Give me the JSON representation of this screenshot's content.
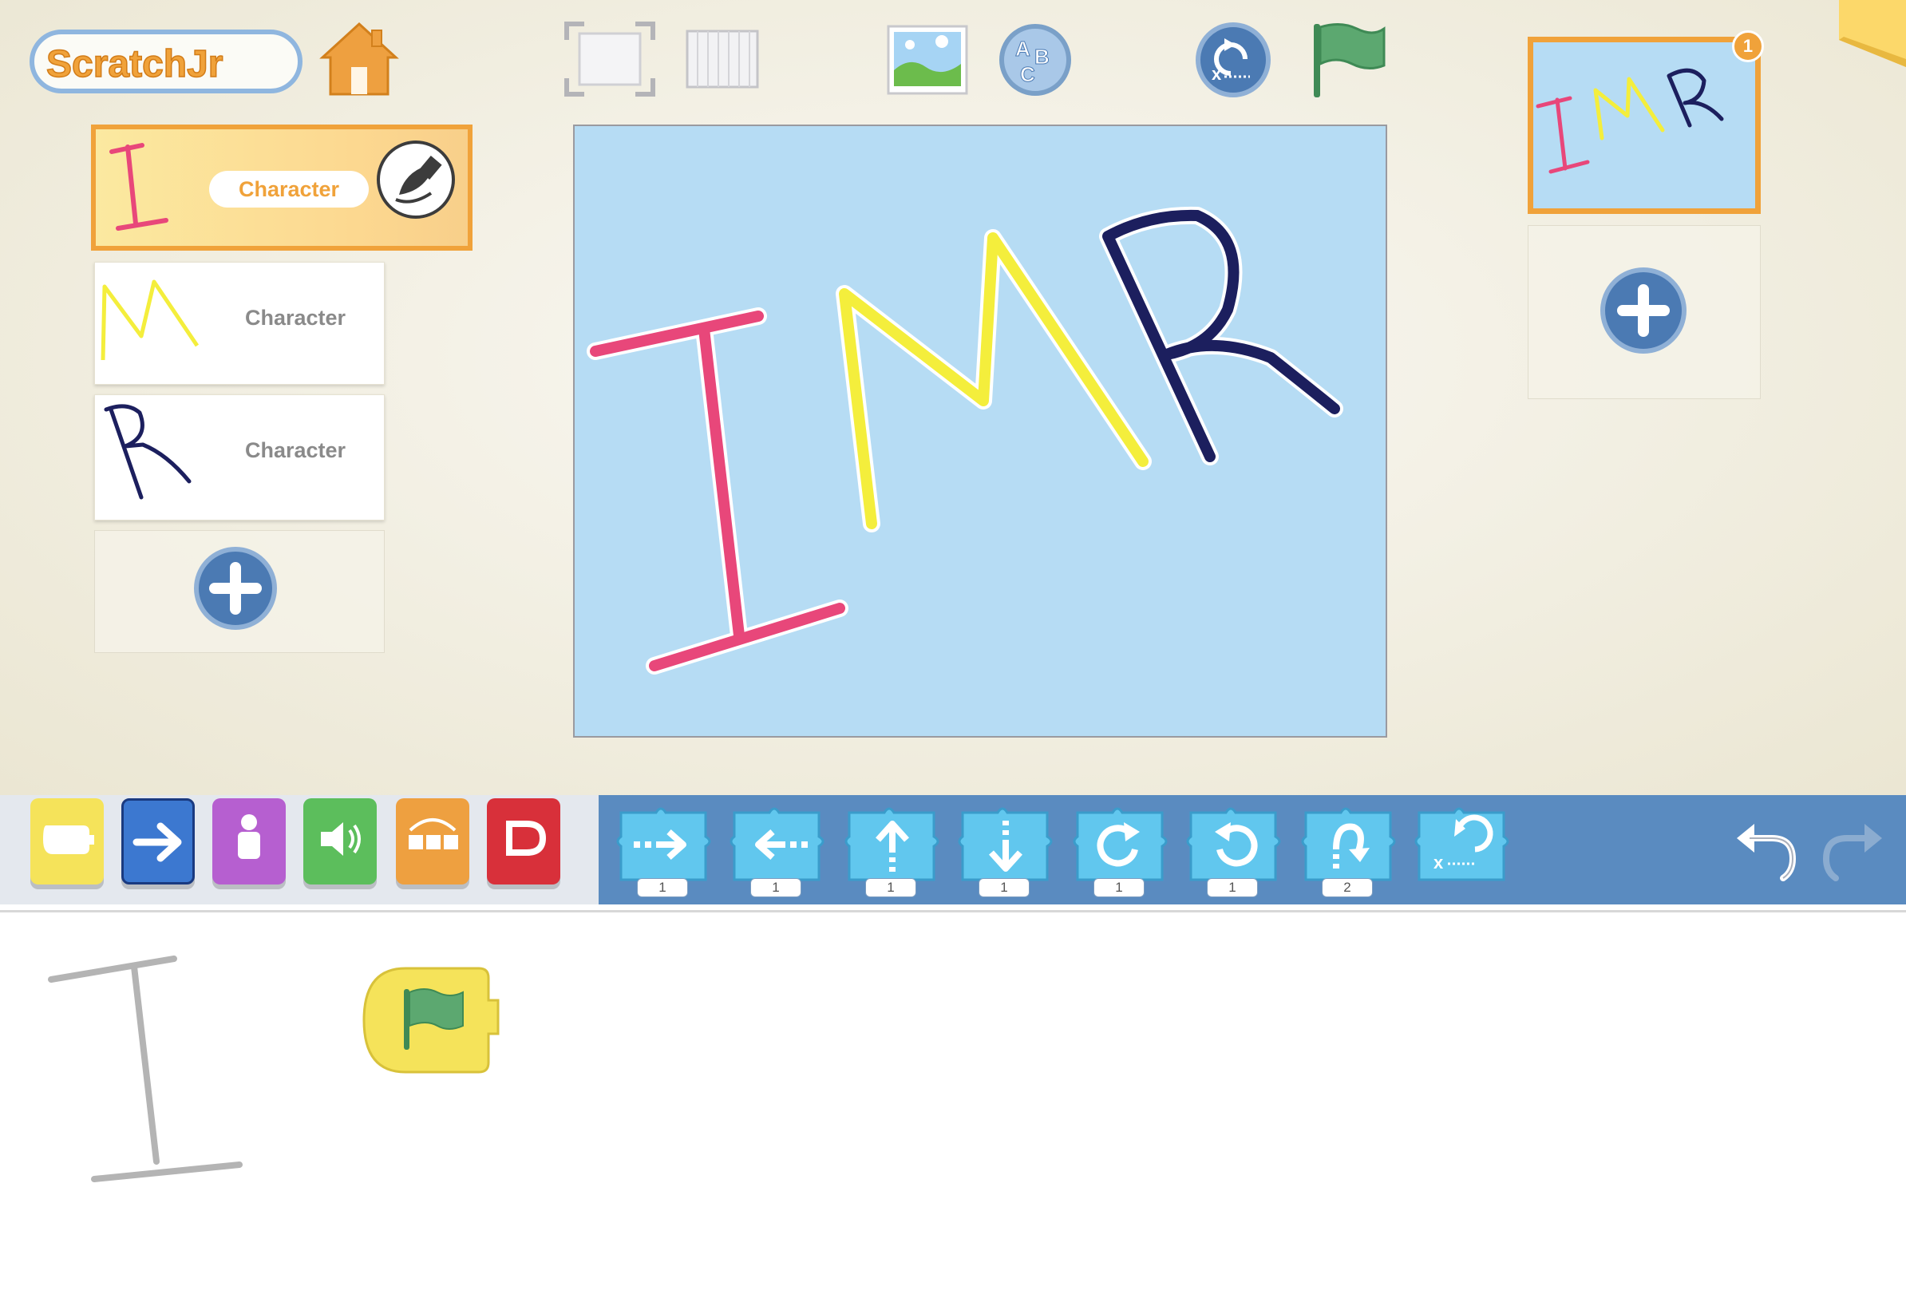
{
  "app": {
    "logo_text": "ScratchJr"
  },
  "toolbar": {
    "home_icon": "home-icon",
    "fullscreen_icon": "fullscreen-icon",
    "grid_icon": "grid-icon",
    "background_icon": "background-icon",
    "text_icon": "add-text-icon",
    "reset_icon": "reset-icon",
    "green_flag_icon": "green-flag-icon"
  },
  "sprites": [
    {
      "name": "Character",
      "letter": "I",
      "color": "#e8477a",
      "selected": true
    },
    {
      "name": "Character",
      "letter": "M",
      "color": "#f4ee3c",
      "selected": false
    },
    {
      "name": "Character",
      "letter": "R",
      "color": "#1c1f5e",
      "selected": false
    }
  ],
  "pages": {
    "current_page_number": "1",
    "add_page_icon": "add-icon"
  },
  "palette": {
    "categories": [
      {
        "name": "triggering",
        "color": "#f5e35a"
      },
      {
        "name": "motion",
        "color": "#3c78d0"
      },
      {
        "name": "looks",
        "color": "#b65fd0"
      },
      {
        "name": "sound",
        "color": "#5cbe5c"
      },
      {
        "name": "control",
        "color": "#eea040"
      },
      {
        "name": "end",
        "color": "#d8303a"
      }
    ],
    "blocks": [
      {
        "name": "move-right",
        "count": "1"
      },
      {
        "name": "move-left",
        "count": "1"
      },
      {
        "name": "move-up",
        "count": "1"
      },
      {
        "name": "move-down",
        "count": "1"
      },
      {
        "name": "turn-right",
        "count": "1"
      },
      {
        "name": "turn-left",
        "count": "1"
      },
      {
        "name": "hop",
        "count": "2"
      },
      {
        "name": "go-home",
        "count": ""
      }
    ],
    "undo_icon": "undo-icon",
    "redo_icon": "redo-icon"
  },
  "script": {
    "trigger_block": "green-flag-trigger",
    "sprite_letter": "I"
  }
}
